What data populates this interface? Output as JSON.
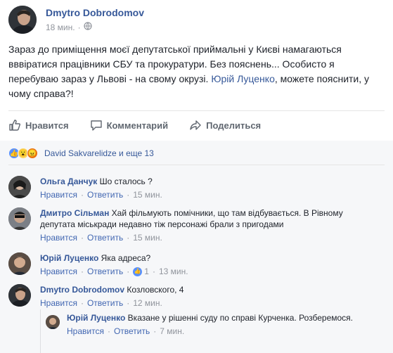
{
  "post": {
    "author": "Dmytro Dobrodomov",
    "time": "18 мин.",
    "audience_icon": "globe-icon",
    "text_before_mention": "Зараз до приміщення моєї депутатської приймальні у Києві намагаються вввіратися працівники СБУ та прокуратури. Без пояснень... Особисто я перебуваю зараз у Львові - на свому окрузі. ",
    "mention": "Юрій Луценко",
    "text_after_mention": ", можете пояснити, у чому справа?!"
  },
  "actions": {
    "like": "Нравится",
    "comment": "Комментарий",
    "share": "Поделиться"
  },
  "reactions": {
    "icons": [
      "like-reaction-icon",
      "wow-reaction-icon",
      "angry-reaction-icon"
    ],
    "text": "David Sakvarelidze и еще 13"
  },
  "comments": [
    {
      "author": "Ольга Данчук",
      "text": "Шо сталось ?",
      "like_label": "Нравится",
      "reply_label": "Ответить",
      "time": "15 мин."
    },
    {
      "author": "Дмитро Сільман",
      "text": "Хай фільмують помічники, що там відбувається. В Рівному депутата міськради недавно тіж персонажі брали з пригодами",
      "like_label": "Нравится",
      "reply_label": "Ответить",
      "time": "15 мин."
    },
    {
      "author": "Юрій Луценко",
      "text": "Яка адреса?",
      "like_label": "Нравится",
      "reply_label": "Ответить",
      "likes": "1",
      "time": "13 мин."
    },
    {
      "author": "Dmytro Dobrodomov",
      "text": "Козловского, 4",
      "like_label": "Нравится",
      "reply_label": "Ответить",
      "time": "12 мин."
    }
  ],
  "reply": {
    "author": "Юрій Луценко",
    "text": "Вказане у рішенні суду по справі Курченка. Розберемося.",
    "like_label": "Нравится",
    "reply_label": "Ответить",
    "time": "7 мин."
  },
  "colors": {
    "link": "#365899",
    "secondary": "#90949c",
    "like_blue": "#5890ff",
    "comments_bg": "#f6f7f9"
  }
}
